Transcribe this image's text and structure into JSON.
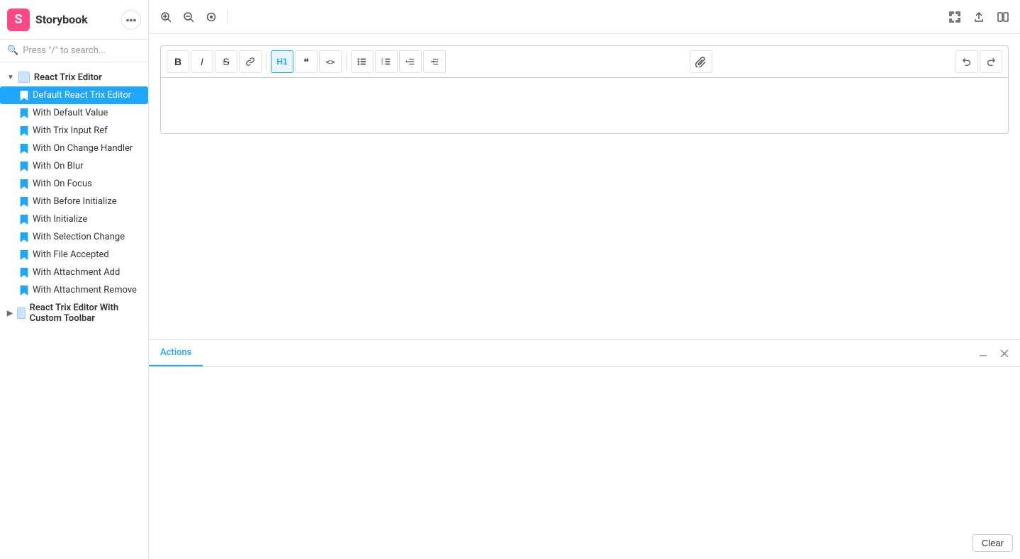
{
  "sidebar": {
    "logo_text": "Storybook",
    "search_placeholder": "Press \"/\" to search...",
    "groups": [
      {
        "id": "react-trix-editor",
        "label": "React Trix Editor",
        "expanded": true,
        "items": [
          {
            "id": "default-react-trix-editor",
            "label": "Default React Trix Editor",
            "active": true
          },
          {
            "id": "with-default-value",
            "label": "With Default Value",
            "active": false
          },
          {
            "id": "with-trix-input-ref",
            "label": "With Trix Input Ref",
            "active": false
          },
          {
            "id": "with-on-change-handler",
            "label": "With On Change Handler",
            "active": false
          },
          {
            "id": "with-on-blur",
            "label": "With On Blur",
            "active": false
          },
          {
            "id": "with-on-focus",
            "label": "With On Focus",
            "active": false
          },
          {
            "id": "with-before-initialize",
            "label": "With Before Initialize",
            "active": false
          },
          {
            "id": "with-initialize",
            "label": "With Initialize",
            "active": false
          },
          {
            "id": "with-selection-change",
            "label": "With Selection Change",
            "active": false
          },
          {
            "id": "with-file-accepted",
            "label": "With File Accepted",
            "active": false
          },
          {
            "id": "with-attachment-add",
            "label": "With Attachment Add",
            "active": false
          },
          {
            "id": "with-attachment-remove",
            "label": "With Attachment Remove",
            "active": false
          }
        ]
      },
      {
        "id": "react-trix-editor-custom",
        "label": "React Trix Editor With Custom Toolbar",
        "expanded": false,
        "items": []
      }
    ]
  },
  "topbar": {
    "zoom_in_label": "⊕",
    "zoom_out_label": "⊖",
    "zoom_reset_label": "⊙",
    "fullscreen_label": "⛶",
    "share_label": "↑",
    "split_label": "⧉"
  },
  "toolbar": {
    "buttons": [
      {
        "id": "bold",
        "label": "B",
        "title": "Bold",
        "active": false,
        "style": "font-weight:bold"
      },
      {
        "id": "italic",
        "label": "I",
        "title": "Italic",
        "active": false,
        "style": "font-style:italic"
      },
      {
        "id": "strike",
        "label": "S̶",
        "title": "Strikethrough",
        "active": false,
        "style": ""
      },
      {
        "id": "link",
        "label": "🔗",
        "title": "Link",
        "active": false,
        "style": "font-size:13px"
      }
    ],
    "heading_btn": {
      "id": "heading",
      "label": "H1",
      "title": "Heading",
      "active": true
    },
    "quote_btn": {
      "id": "quote",
      "label": "❝",
      "title": "Quote",
      "active": false
    },
    "code_btn": {
      "id": "code",
      "label": "<>",
      "title": "Code",
      "active": false
    },
    "list_btns": [
      {
        "id": "bullet-list",
        "label": "≡",
        "title": "Bullet List",
        "active": false
      },
      {
        "id": "ordered-list",
        "label": "1≡",
        "title": "Ordered List",
        "active": false
      },
      {
        "id": "indent-decrease",
        "label": "⇤≡",
        "title": "Decrease Indent",
        "active": false
      },
      {
        "id": "indent-increase",
        "label": "≡⇥",
        "title": "Increase Indent",
        "active": false
      }
    ],
    "attach_btn": {
      "id": "attach",
      "label": "📎",
      "title": "Attach File",
      "active": false
    },
    "undo_btn": {
      "id": "undo",
      "label": "↩",
      "title": "Undo",
      "active": false
    },
    "redo_btn": {
      "id": "redo",
      "label": "↪",
      "title": "Redo",
      "active": false
    }
  },
  "editor": {
    "placeholder": ""
  },
  "bottom_panel": {
    "tabs": [
      {
        "id": "actions",
        "label": "Actions",
        "active": true
      }
    ],
    "clear_button_label": "Clear"
  }
}
